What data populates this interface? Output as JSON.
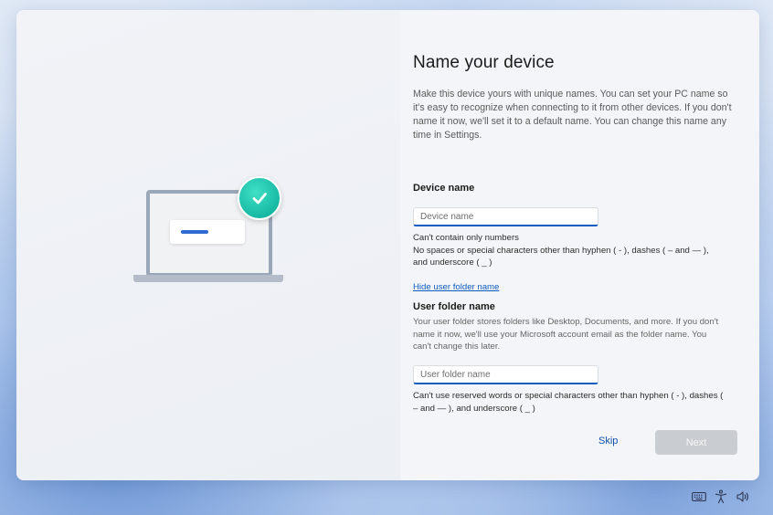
{
  "setup": {
    "title": "Name your device",
    "description": "Make this device yours with unique names. You can set your PC name so it's easy to recognize when connecting to it from other devices. If you don't name it now, we'll set it to a default name. You can change this name any time in Settings.",
    "device_name": {
      "label": "Device name",
      "placeholder": "Device name",
      "value": "",
      "hint_line1": "Can't contain only numbers",
      "hint_line2": "No spaces or special characters other than hyphen ( - ), dashes ( – and — ), and underscore ( _ )"
    },
    "toggle_link": "Hide user folder name",
    "user_folder": {
      "label": "User folder name",
      "description": "Your user folder stores folders like Desktop, Documents, and more. If you don't name it now, we'll use your Microsoft account email as the folder name. You can't change this later.",
      "placeholder": "User folder name",
      "value": "",
      "hint": "Can't use reserved words or special characters other than hyphen ( - ), dashes ( – and — ), and underscore ( _ )"
    },
    "buttons": {
      "skip": "Skip",
      "next": "Next"
    }
  },
  "illustration": {
    "icons": [
      "laptop-icon",
      "check-badge-icon"
    ],
    "accent_color": "#17b9a4",
    "bar_color": "#2f6ad3"
  },
  "tray": {
    "icons": [
      "keyboard-icon",
      "accessibility-icon",
      "volume-icon"
    ]
  },
  "colors": {
    "accent": "#0f5cc0",
    "next_disabled": "#c9ccd1",
    "card_background": "#f3f5f8"
  }
}
